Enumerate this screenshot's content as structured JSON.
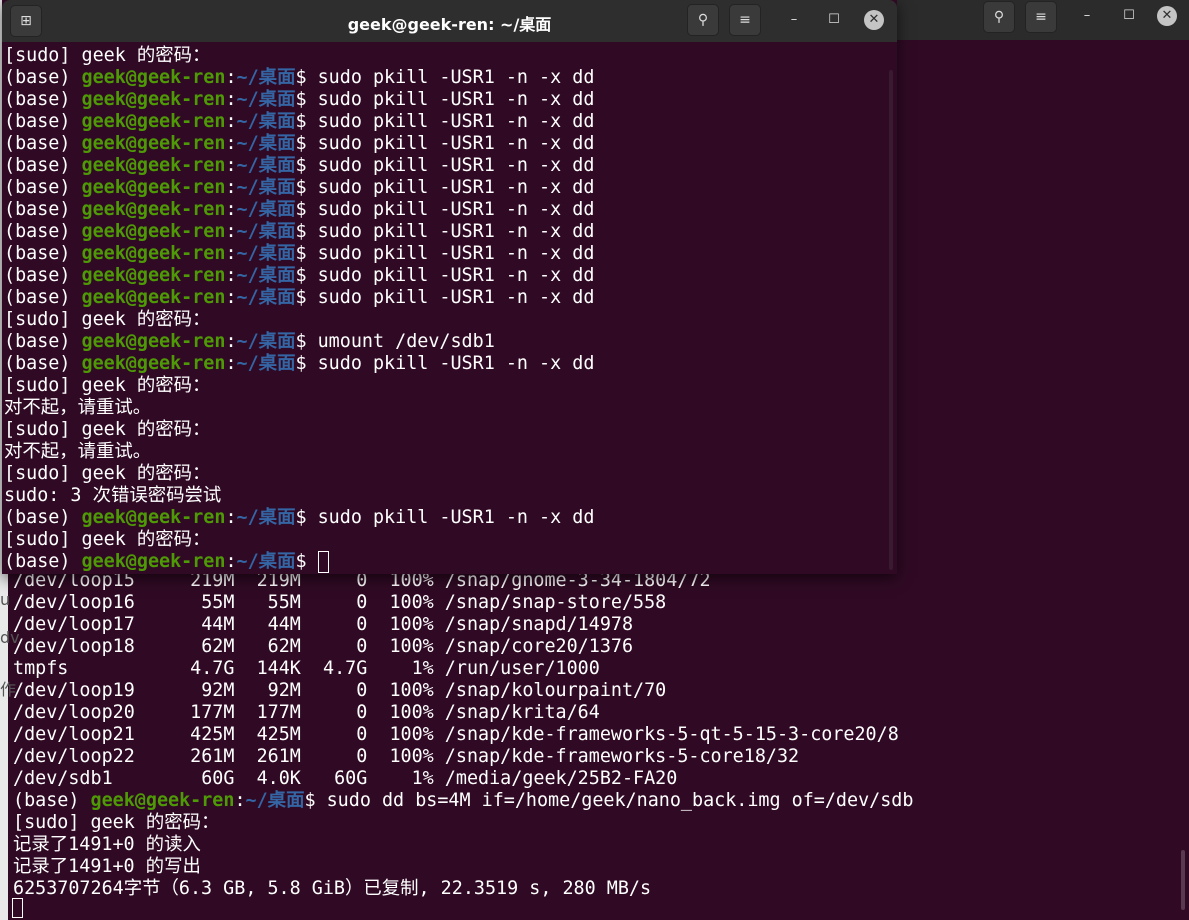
{
  "colors": {
    "terminal_bg": "#300a24",
    "titlebar_bg": "#2e2e2e",
    "prompt_user": "#4e9a06",
    "prompt_path": "#3465a4",
    "text": "#ffffff"
  },
  "front_window": {
    "title": "geek@geek-ren: ~/桌面",
    "new_tab_icon": "new-tab-icon",
    "search_icon": "search-icon",
    "menu_icon": "hamburger-menu-icon",
    "minimize_icon": "minimize-icon",
    "maximize_icon": "maximize-icon",
    "close_icon": "close-icon",
    "lines": [
      {
        "type": "text",
        "text": "[sudo] geek 的密码："
      },
      {
        "type": "prompt",
        "base": "(base) ",
        "user": "geek@geek-ren",
        "sep": ":",
        "path": "~/桌面",
        "cmd": "$ sudo pkill -USR1 -n -x dd"
      },
      {
        "type": "prompt",
        "base": "(base) ",
        "user": "geek@geek-ren",
        "sep": ":",
        "path": "~/桌面",
        "cmd": "$ sudo pkill -USR1 -n -x dd"
      },
      {
        "type": "prompt",
        "base": "(base) ",
        "user": "geek@geek-ren",
        "sep": ":",
        "path": "~/桌面",
        "cmd": "$ sudo pkill -USR1 -n -x dd"
      },
      {
        "type": "prompt",
        "base": "(base) ",
        "user": "geek@geek-ren",
        "sep": ":",
        "path": "~/桌面",
        "cmd": "$ sudo pkill -USR1 -n -x dd"
      },
      {
        "type": "prompt",
        "base": "(base) ",
        "user": "geek@geek-ren",
        "sep": ":",
        "path": "~/桌面",
        "cmd": "$ sudo pkill -USR1 -n -x dd"
      },
      {
        "type": "prompt",
        "base": "(base) ",
        "user": "geek@geek-ren",
        "sep": ":",
        "path": "~/桌面",
        "cmd": "$ sudo pkill -USR1 -n -x dd"
      },
      {
        "type": "prompt",
        "base": "(base) ",
        "user": "geek@geek-ren",
        "sep": ":",
        "path": "~/桌面",
        "cmd": "$ sudo pkill -USR1 -n -x dd"
      },
      {
        "type": "prompt",
        "base": "(base) ",
        "user": "geek@geek-ren",
        "sep": ":",
        "path": "~/桌面",
        "cmd": "$ sudo pkill -USR1 -n -x dd"
      },
      {
        "type": "prompt",
        "base": "(base) ",
        "user": "geek@geek-ren",
        "sep": ":",
        "path": "~/桌面",
        "cmd": "$ sudo pkill -USR1 -n -x dd"
      },
      {
        "type": "prompt",
        "base": "(base) ",
        "user": "geek@geek-ren",
        "sep": ":",
        "path": "~/桌面",
        "cmd": "$ sudo pkill -USR1 -n -x dd"
      },
      {
        "type": "prompt",
        "base": "(base) ",
        "user": "geek@geek-ren",
        "sep": ":",
        "path": "~/桌面",
        "cmd": "$ sudo pkill -USR1 -n -x dd"
      },
      {
        "type": "text",
        "text": "[sudo] geek 的密码："
      },
      {
        "type": "prompt",
        "base": "(base) ",
        "user": "geek@geek-ren",
        "sep": ":",
        "path": "~/桌面",
        "cmd": "$ umount /dev/sdb1"
      },
      {
        "type": "prompt",
        "base": "(base) ",
        "user": "geek@geek-ren",
        "sep": ":",
        "path": "~/桌面",
        "cmd": "$ sudo pkill -USR1 -n -x dd"
      },
      {
        "type": "text",
        "text": "[sudo] geek 的密码："
      },
      {
        "type": "text",
        "text": "对不起，请重试。"
      },
      {
        "type": "text",
        "text": "[sudo] geek 的密码："
      },
      {
        "type": "text",
        "text": "对不起，请重试。"
      },
      {
        "type": "text",
        "text": "[sudo] geek 的密码："
      },
      {
        "type": "text",
        "text": "sudo: 3 次错误密码尝试"
      },
      {
        "type": "prompt",
        "base": "(base) ",
        "user": "geek@geek-ren",
        "sep": ":",
        "path": "~/桌面",
        "cmd": "$ sudo pkill -USR1 -n -x dd"
      },
      {
        "type": "text",
        "text": "[sudo] geek 的密码："
      },
      {
        "type": "prompt_cursor",
        "base": "(base) ",
        "user": "geek@geek-ren",
        "sep": ":",
        "path": "~/桌面",
        "cmd": "$ "
      }
    ]
  },
  "back_window": {
    "search_icon": "search-icon",
    "menu_icon": "hamburger-menu-icon",
    "strip_fragments": [
      "u",
      "dv",
      "作"
    ],
    "lines": [
      {
        "type": "text",
        "text": "/dev/loop15     219M  219M     0  100% /snap/gnome-3-34-1804/72"
      },
      {
        "type": "text",
        "text": "/dev/loop16      55M   55M     0  100% /snap/snap-store/558"
      },
      {
        "type": "text",
        "text": "/dev/loop17      44M   44M     0  100% /snap/snapd/14978"
      },
      {
        "type": "text",
        "text": "/dev/loop18      62M   62M     0  100% /snap/core20/1376"
      },
      {
        "type": "text",
        "text": "tmpfs           4.7G  144K  4.7G    1% /run/user/1000"
      },
      {
        "type": "text",
        "text": "/dev/loop19      92M   92M     0  100% /snap/kolourpaint/70"
      },
      {
        "type": "text",
        "text": "/dev/loop20     177M  177M     0  100% /snap/krita/64"
      },
      {
        "type": "text",
        "text": "/dev/loop21     425M  425M     0  100% /snap/kde-frameworks-5-qt-5-15-3-core20/8"
      },
      {
        "type": "text",
        "text": "/dev/loop22     261M  261M     0  100% /snap/kde-frameworks-5-core18/32"
      },
      {
        "type": "text",
        "text": "/dev/sdb1        60G  4.0K   60G    1% /media/geek/25B2-FA20"
      },
      {
        "type": "prompt",
        "base": "(base) ",
        "user": "geek@geek-ren",
        "sep": ":",
        "path": "~/桌面",
        "cmd": "$ sudo dd bs=4M if=/home/geek/nano_back.img of=/dev/sdb"
      },
      {
        "type": "text",
        "text": "[sudo] geek 的密码："
      },
      {
        "type": "text",
        "text": "记录了1491+0 的读入"
      },
      {
        "type": "text",
        "text": "记录了1491+0 的写出"
      },
      {
        "type": "text",
        "text": "6253707264字节（6.3 GB, 5.8 GiB）已复制, 22.3519 s, 280 MB/s"
      }
    ]
  }
}
